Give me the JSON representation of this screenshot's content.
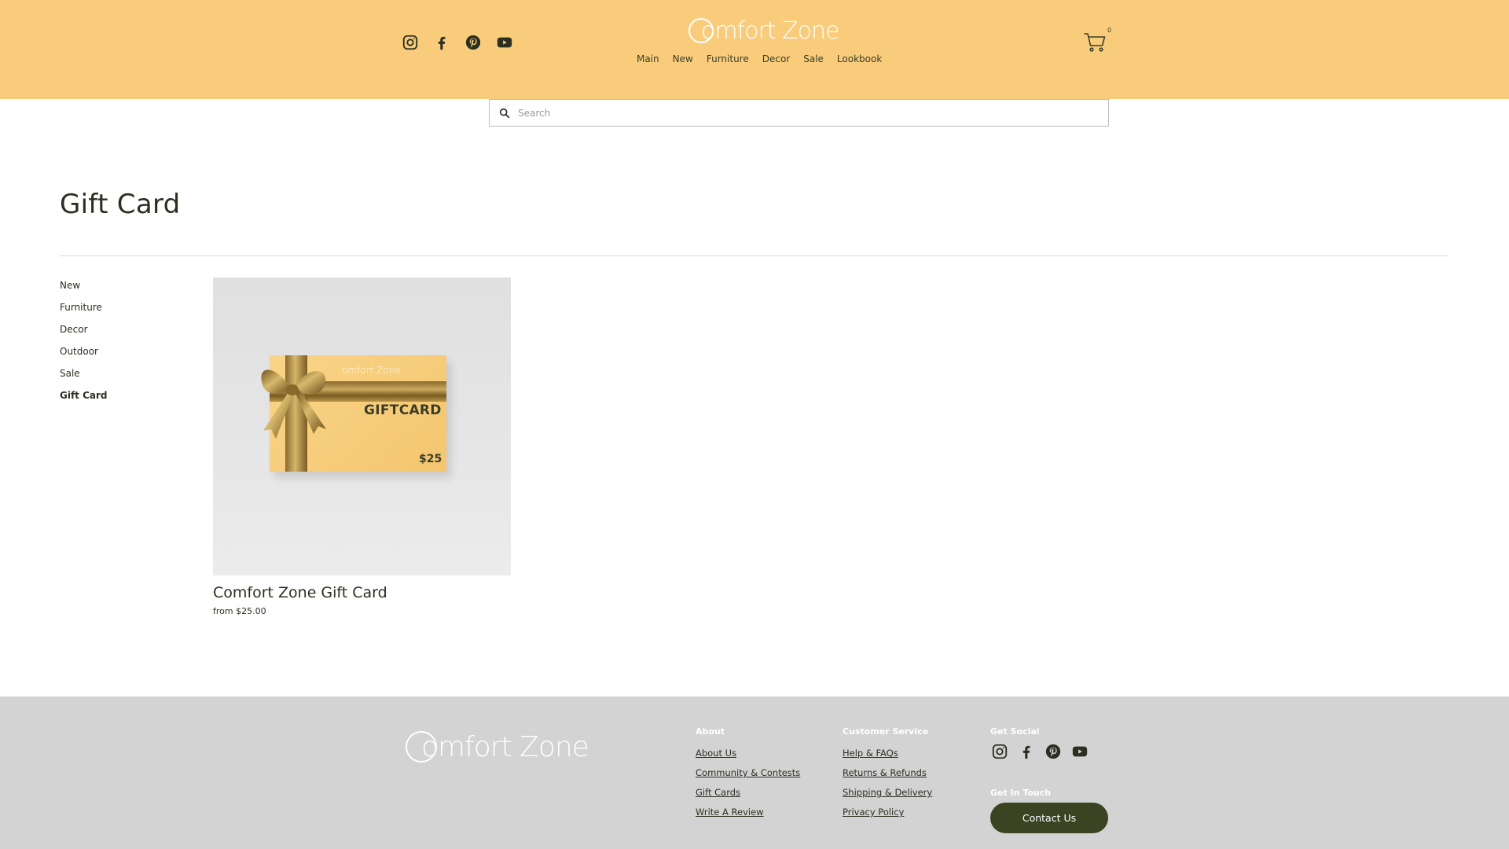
{
  "header": {
    "brand": "omfort Zone",
    "nav": [
      "Main",
      "New",
      "Furniture",
      "Decor",
      "Sale",
      "Lookbook"
    ],
    "cart_count": "0",
    "social_icons": [
      "instagram-icon",
      "facebook-icon",
      "pinterest-icon",
      "youtube-icon"
    ]
  },
  "search": {
    "placeholder": "Search"
  },
  "page": {
    "title": "Gift Card"
  },
  "categories": [
    {
      "label": "New",
      "active": false
    },
    {
      "label": "Furniture",
      "active": false
    },
    {
      "label": "Decor",
      "active": false
    },
    {
      "label": "Outdoor",
      "active": false
    },
    {
      "label": "Sale",
      "active": false
    },
    {
      "label": "Gift Card",
      "active": true
    }
  ],
  "product": {
    "name": "Comfort Zone Gift Card",
    "price": "from $25.00",
    "card_logo": "omfort Zone",
    "card_title": "GIFTCARD",
    "card_price": "$25"
  },
  "footer": {
    "brand": "omfort Zone",
    "about": {
      "heading": "About",
      "links": [
        "About Us",
        "Community & Contests",
        "Gift Cards",
        "Write A Review"
      ]
    },
    "service": {
      "heading": "Customer Service",
      "links": [
        "Help & FAQs",
        "Returns & Refunds",
        "Shipping & Delivery",
        "Privacy Policy"
      ]
    },
    "social": {
      "heading": "Get Social"
    },
    "touch": {
      "heading": "Get In Touch",
      "button": "Contact Us"
    }
  },
  "colors": {
    "header_bg": "#f8cc7a",
    "footer_bg": "#d3d3d3",
    "button_bg": "#3a4422",
    "text": "#2b2f22"
  }
}
